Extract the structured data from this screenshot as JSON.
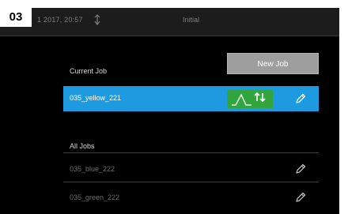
{
  "figure_label": "03",
  "statusbar": {
    "date_time": "1 2017, 20:57",
    "arrow_icon": "usb-arrow-icon",
    "mode": "Initial"
  },
  "actions": {
    "new_job_label": "New Job"
  },
  "current_job": {
    "section_label": "Current Job",
    "name": "035_yellow_221",
    "status_icon": "curve-swap-icon",
    "edit_icon": "pencil-icon",
    "highlight_color": "#1e9be0",
    "status_color": "#33a53e"
  },
  "all_jobs": {
    "section_label": "All Jobs",
    "items": [
      {
        "name": "035_blue_222",
        "edit_icon": "pencil-icon"
      },
      {
        "name": "035_green_222",
        "edit_icon": "pencil-icon"
      }
    ]
  }
}
